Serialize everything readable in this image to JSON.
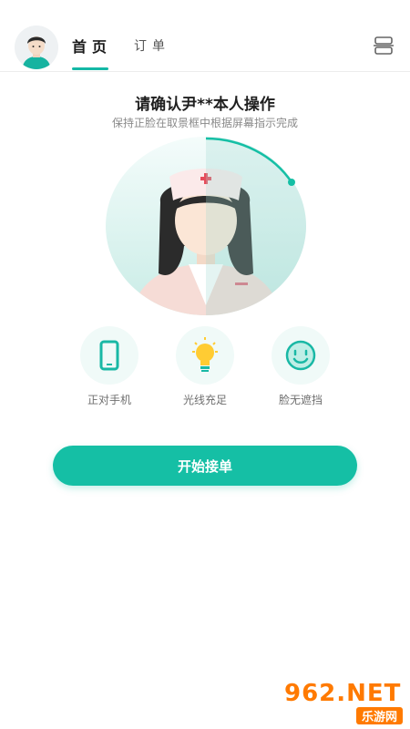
{
  "header": {
    "tabs": [
      {
        "label": "首页",
        "active": true
      },
      {
        "label": "订单",
        "active": false
      }
    ]
  },
  "verify": {
    "title": "请确认尹**本人操作",
    "subtitle": "保持正脸在取景框中根据屏幕指示完成"
  },
  "tips": [
    {
      "icon": "phone-icon",
      "label": "正对手机"
    },
    {
      "icon": "lightbulb-icon",
      "label": "光线充足"
    },
    {
      "icon": "smile-face-icon",
      "label": "脸无遮挡"
    }
  ],
  "start_button": {
    "label": "开始接单"
  },
  "watermark": {
    "main": "962.NET",
    "sub": "乐游网"
  },
  "colors": {
    "accent": "#15bfa5",
    "watermark": "#ff7a00"
  }
}
